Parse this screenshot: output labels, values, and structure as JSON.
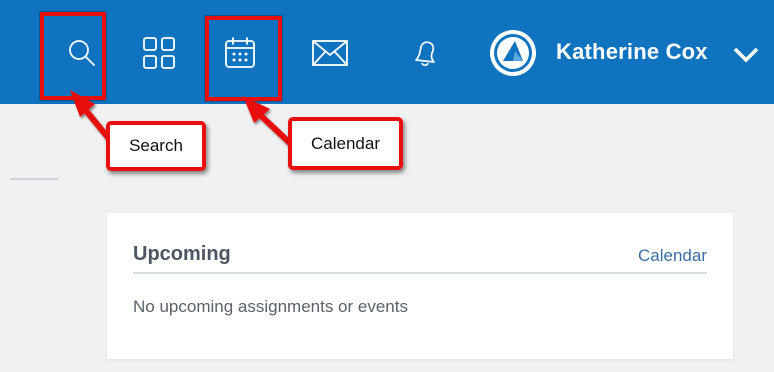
{
  "header": {
    "background": "#0f73bf",
    "icons": [
      "search-icon",
      "apps-grid-icon",
      "calendar-icon",
      "envelope-icon",
      "bell-icon",
      "chevron-down-icon"
    ],
    "user_name": "Katherine Cox"
  },
  "annotations": {
    "color": "#e8100e",
    "callouts": [
      {
        "label": "Search",
        "target": "search-icon"
      },
      {
        "label": "Calendar",
        "target": "calendar-icon"
      }
    ]
  },
  "upcoming": {
    "title": "Upcoming",
    "link_label": "Calendar",
    "empty_text": "No upcoming assignments or events"
  }
}
